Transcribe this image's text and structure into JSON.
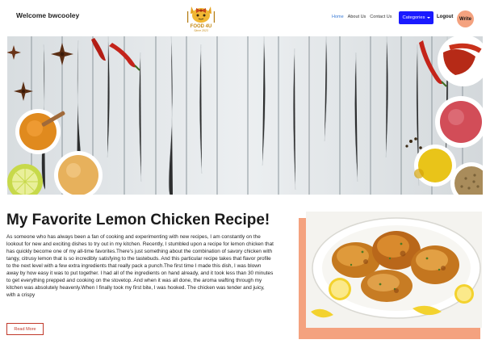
{
  "navbar": {
    "welcome": "Welcome bwcooley",
    "logo": {
      "name": "FOOD 4U",
      "tagline": "Since 2023"
    },
    "links": [
      {
        "label": "Home",
        "active": true
      },
      {
        "label": "About Us",
        "active": false
      },
      {
        "label": "Contact Us",
        "active": false
      }
    ],
    "categories_label": "Categories",
    "logout_label": "Logout",
    "write_label": "Write",
    "colors": {
      "categories_bg": "#1a1aff",
      "write_bg": "#f4a27f",
      "active_link": "#3a7bd5"
    }
  },
  "hero": {
    "icon": "spices-wooden-table-image"
  },
  "post": {
    "title": "My Favorite Lemon Chicken Recipe!",
    "description": "As someone who has always been a fan of cooking and experimenting with new recipes, I am constantly on the lookout for new and exciting dishes to try out in my kitchen. Recently, I stumbled upon a recipe for lemon chicken that has quickly become one of my all-time favorites.There's just something about the combination of savory chicken with tangy, citrusy lemon that is so incredibly satisfying to the tastebuds. And this particular recipe takes that flavor profile to the next level with a few extra ingredients that really pack a punch.The first time I made this dish, I was blown away by how easy it was to put together. I had all of the ingredients on hand already, and it took less than 30 minutes to get everything prepped and cooking on the stovetop. And when it was all done, the aroma wafting through my kitchen was absolutely heavenly.When I finally took my first bite, I was hooked. The chicken was tender and juicy, with a crispy",
    "read_more_label": "Read More",
    "image_icon": "lemon-chicken-plate-image",
    "colors": {
      "read_more": "#c0392b",
      "image_accent": "#f4a27f"
    }
  }
}
